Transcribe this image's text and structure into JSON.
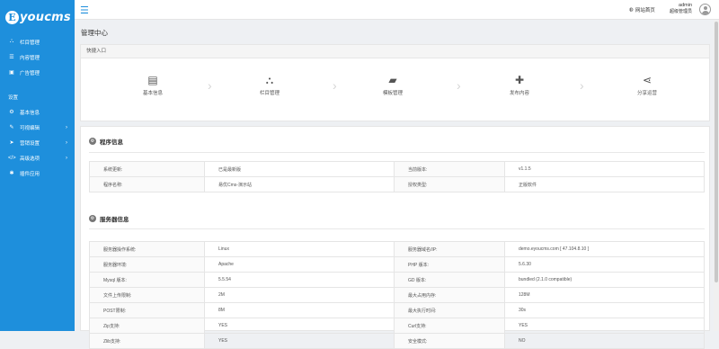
{
  "logo": {
    "mark": "E",
    "text": "youcms"
  },
  "sidebar": {
    "items": [
      {
        "icon": "sitemap-icon",
        "glyph": "⛬",
        "label": "栏目管理"
      },
      {
        "icon": "list-icon",
        "glyph": "☰",
        "label": "内容管理"
      },
      {
        "icon": "image-icon",
        "glyph": "▣",
        "label": "广告管理"
      }
    ],
    "settings_heading": "设置",
    "settings": [
      {
        "icon": "gear-icon",
        "glyph": "⚙",
        "label": "基本信息",
        "arrow": ""
      },
      {
        "icon": "edit-icon",
        "glyph": "✎",
        "label": "可视编辑",
        "arrow": "›"
      },
      {
        "icon": "send-icon",
        "glyph": "➤",
        "label": "营销设置",
        "arrow": "›"
      },
      {
        "icon": "code-icon",
        "glyph": "</>",
        "label": "高级选项",
        "arrow": "›"
      },
      {
        "icon": "plugin-icon",
        "glyph": "✱",
        "label": "插件应用",
        "arrow": ""
      }
    ]
  },
  "topbar": {
    "site_link": "网站首页",
    "user_name": "admin",
    "user_role": "超级管理员"
  },
  "page_title": "管理中心",
  "quick_access": {
    "title": "快捷入口",
    "items": [
      {
        "icon": "id-card-icon",
        "glyph": "▤",
        "label": "基本信息"
      },
      {
        "icon": "sitemap-icon",
        "glyph": "⛬",
        "label": "栏目管理"
      },
      {
        "icon": "folder-open-icon",
        "glyph": "▰",
        "label": "模板管理"
      },
      {
        "icon": "plus-icon",
        "glyph": "✚",
        "label": "发布内容"
      },
      {
        "icon": "share-icon",
        "glyph": "⋖",
        "label": "分享运营"
      }
    ],
    "separator": "›"
  },
  "program_info": {
    "title": "程序信息",
    "rows": [
      [
        "系统更新:",
        "已是最新版",
        "当前版本:",
        "v1.1.5"
      ],
      [
        "程序名称:",
        "易优Cms-演示站",
        "授权类型:",
        "正版软件"
      ]
    ]
  },
  "server_info": {
    "title": "服务器信息",
    "rows": [
      [
        "服务器操作系统:",
        "Linux",
        "服务器域名/IP:",
        "demo.eyoucms.com [ 47.104.8.10 ]"
      ],
      [
        "服务器环境:",
        "Apache",
        "PHP 版本:",
        "5.6.30"
      ],
      [
        "Mysql 版本:",
        "5.5.54",
        "GD 版本:",
        "bundled (2.1.0 compatible)"
      ],
      [
        "文件上传限制:",
        "2M",
        "最大占用内存:",
        "128M"
      ],
      [
        "POST限制:",
        "8M",
        "最大执行时间:",
        "30s"
      ],
      [
        "Zip支持:",
        "YES",
        "Curl支持:",
        "YES"
      ],
      [
        "Zlib支持:",
        "YES",
        "安全模式:",
        "NO"
      ]
    ]
  },
  "colors": {
    "sidebar_bg": "#1e8fdc",
    "page_bg": "#eef0f3"
  }
}
